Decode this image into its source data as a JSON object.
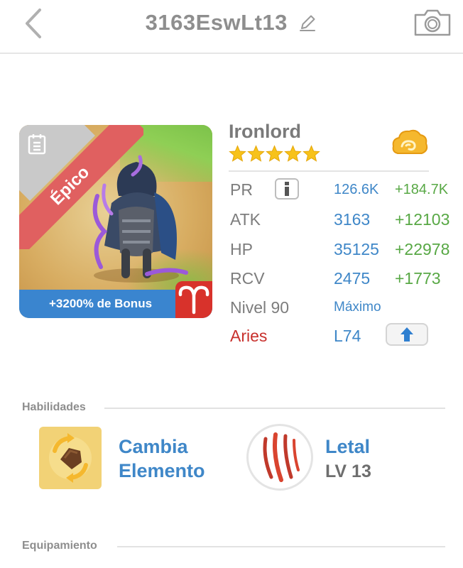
{
  "header": {
    "title": "3163EswLt13"
  },
  "card": {
    "rarity": "Épico",
    "bonus": "+3200% de Bonus"
  },
  "hero": {
    "name": "Ironlord",
    "stars": 5
  },
  "stats": {
    "pr_label": "PR",
    "pr_value": "126.6K",
    "pr_bonus": "+184.7K",
    "atk_label": "ATK",
    "atk_value": "3163",
    "atk_bonus": "+12103",
    "hp_label": "HP",
    "hp_value": "35125",
    "hp_bonus": "+22978",
    "rcv_label": "RCV",
    "rcv_value": "2475",
    "rcv_bonus": "+1773",
    "level_label": "Nivel 90",
    "level_status": "Máximo",
    "zodiac_label": "Aries",
    "zodiac_level": "L74"
  },
  "skills": {
    "section_title": "Habilidades",
    "skill1_line1": "Cambia",
    "skill1_line2": "Elemento",
    "skill2_name": "Letal",
    "skill2_level": "LV 13"
  },
  "equipment": {
    "section_title": "Equipamiento"
  },
  "colors": {
    "accent_blue": "#3f87c8",
    "bonus_green": "#58a845",
    "zodiac_red": "#c8302c",
    "rarity_ribbon": "#e06060",
    "bonus_bar": "#3a85cf"
  },
  "icons": [
    "back-chevron-icon",
    "edit-pencil-icon",
    "camera-icon",
    "document-icon",
    "aries-icon",
    "coin-cloud-icon",
    "info-icon",
    "arrow-up-icon",
    "swap-element-icon",
    "claw-slash-icon",
    "star-icon"
  ]
}
